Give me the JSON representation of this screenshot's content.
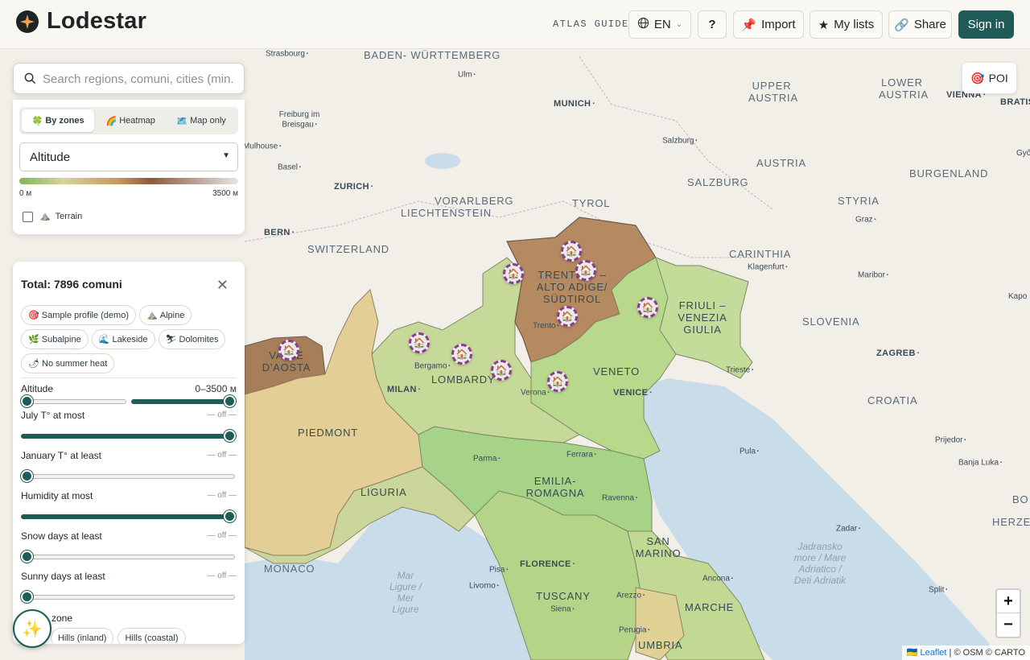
{
  "header": {
    "app_name": "Lodestar",
    "atlas_guide": "ATLAS GUIDE",
    "language": "EN",
    "help": "?",
    "import": "Import",
    "my_lists": "My lists",
    "share": "Share",
    "sign_in": "Sign in"
  },
  "search": {
    "placeholder": "Search regions, comuni, cities (min."
  },
  "mode": {
    "tabs": [
      "By zones",
      "Heatmap",
      "Map only"
    ],
    "tab_icons": [
      "🍀",
      "🌈",
      "🗺️"
    ],
    "active_tab": "By zones",
    "metric": "Altitude",
    "scale_min": "0 м",
    "scale_max": "3500 м",
    "terrain_label": "Terrain",
    "terrain_checked": false
  },
  "filters": {
    "total": "Total: 7896 comuni",
    "presets": [
      {
        "icon": "🎯",
        "label": "Sample profile (demo)"
      },
      {
        "icon": "⛰️",
        "label": "Alpine"
      },
      {
        "icon": "🌿",
        "label": "Subalpine"
      },
      {
        "icon": "🌊",
        "label": "Lakeside"
      },
      {
        "icon": "⛷",
        "label": "Dolomites"
      },
      {
        "icon": "🌶",
        "label": "No summer heat"
      }
    ],
    "sliders": [
      {
        "label": "Altitude",
        "value": "0–3500 м",
        "range": [
          0,
          3500
        ]
      },
      {
        "label": "July T° at most",
        "value": "— off —"
      },
      {
        "label": "January T° at least",
        "value": "— off —"
      },
      {
        "label": "Humidity at most",
        "value": "— off —"
      },
      {
        "label": "Snow days at least",
        "value": "— off —"
      },
      {
        "label": "Sunny days at least",
        "value": "— off —"
      }
    ],
    "season_label": "zone",
    "zone_chips": [
      "ls",
      "Hills (inland)",
      "Hills (coastal)"
    ]
  },
  "poi": {
    "label": "POI",
    "icon": "🎯"
  },
  "zoom": {
    "in": "+",
    "out": "−"
  },
  "attribution": {
    "leaflet": "Leaflet",
    "rest": "| © OSM © CARTO",
    "flag": "🇺🇦"
  },
  "map": {
    "region_labels": [
      "TRENTINO – ALTO ADIGE/ SÜDTIROL",
      "FRIULI – VENEZIA GIULIA",
      "VALLE D'AOSTA",
      "LOMBARDY",
      "VENETO",
      "PIEDMONT",
      "LIGURIA",
      "EMILIA- ROMAGNA",
      "TUSCANY",
      "SAN MARINO",
      "MARCHE",
      "UMBRIA"
    ],
    "country_labels": [
      "BADEN- WÜRTTEMBERG",
      "UPPER AUSTRIA",
      "LOWER AUSTRIA",
      "AUSTRIA",
      "BURGENLAND",
      "VORARLBERG",
      "LIECHTENSTEIN",
      "TYROL",
      "SALZBURG",
      "STYRIA",
      "SWITZERLAND",
      "CARINTHIA",
      "SLOVENIA",
      "CROATIA",
      "MONACO"
    ],
    "sea_labels": [
      "Mar Ligure / Mer Ligure",
      "Jadransko more / Mare Adriatico / Deti Adriatik"
    ],
    "cities": [
      "Strasbourg",
      "Ulm",
      "MUNICH",
      "VIENNA",
      "BRATIS",
      "Freiburg im Breisgau",
      "Mulhouse",
      "Basel",
      "Salzburg",
      "Győ",
      "ZURICH",
      "BERN",
      "Graz",
      "Klagenfurt",
      "Maribor",
      "Kapo",
      "Trento",
      "Bergamo",
      "MILAN",
      "Verona",
      "VENICE",
      "Trieste",
      "ZAGREB",
      "Prijedor",
      "Banja Luka",
      "Parma",
      "Ferrara",
      "Ravenna",
      "Pula",
      "Zadar",
      "Pisa",
      "FLORENCE",
      "Livorno",
      "Arezzo",
      "Siena",
      "Ancona",
      "Perugia",
      "Split",
      "BO",
      "HERZE"
    ]
  }
}
